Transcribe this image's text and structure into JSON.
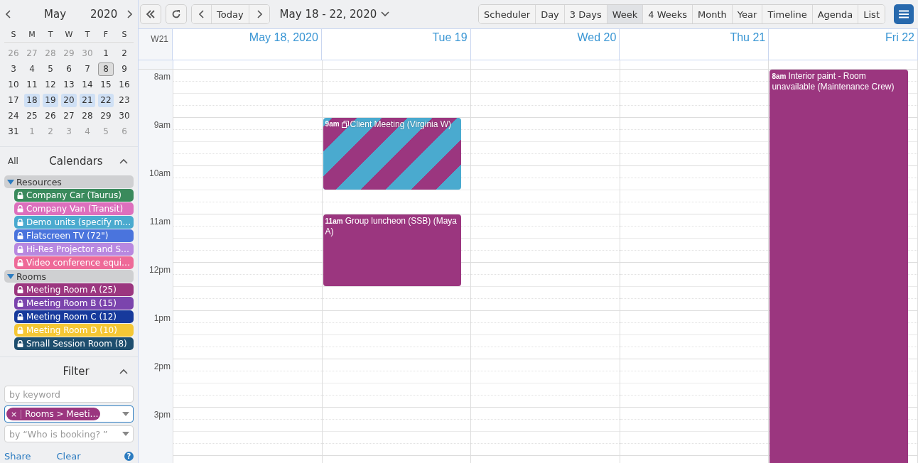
{
  "mini_calendar": {
    "month": "May",
    "year": "2020",
    "weekdays": [
      "S",
      "M",
      "T",
      "W",
      "T",
      "F",
      "S"
    ],
    "weeks": [
      [
        {
          "d": "26",
          "muted": true,
          "selected": false,
          "today": false
        },
        {
          "d": "27",
          "muted": true,
          "selected": false,
          "today": false
        },
        {
          "d": "28",
          "muted": true,
          "selected": false,
          "today": false
        },
        {
          "d": "29",
          "muted": true,
          "selected": false,
          "today": false
        },
        {
          "d": "30",
          "muted": true,
          "selected": false,
          "today": false
        },
        {
          "d": "1",
          "muted": false,
          "selected": false,
          "today": false
        },
        {
          "d": "2",
          "muted": false,
          "selected": false,
          "today": false
        }
      ],
      [
        {
          "d": "3",
          "muted": false,
          "selected": false,
          "today": false
        },
        {
          "d": "4",
          "muted": false,
          "selected": false,
          "today": false
        },
        {
          "d": "5",
          "muted": false,
          "selected": false,
          "today": false
        },
        {
          "d": "6",
          "muted": false,
          "selected": false,
          "today": false
        },
        {
          "d": "7",
          "muted": false,
          "selected": false,
          "today": false
        },
        {
          "d": "8",
          "muted": false,
          "selected": false,
          "today": true
        },
        {
          "d": "9",
          "muted": false,
          "selected": false,
          "today": false
        }
      ],
      [
        {
          "d": "10",
          "muted": false,
          "selected": false,
          "today": false
        },
        {
          "d": "11",
          "muted": false,
          "selected": false,
          "today": false
        },
        {
          "d": "12",
          "muted": false,
          "selected": false,
          "today": false
        },
        {
          "d": "13",
          "muted": false,
          "selected": false,
          "today": false
        },
        {
          "d": "14",
          "muted": false,
          "selected": false,
          "today": false
        },
        {
          "d": "15",
          "muted": false,
          "selected": false,
          "today": false
        },
        {
          "d": "16",
          "muted": false,
          "selected": false,
          "today": false
        }
      ],
      [
        {
          "d": "17",
          "muted": false,
          "selected": false,
          "today": false
        },
        {
          "d": "18",
          "muted": false,
          "selected": true,
          "today": false
        },
        {
          "d": "19",
          "muted": false,
          "selected": true,
          "today": false
        },
        {
          "d": "20",
          "muted": false,
          "selected": true,
          "today": false
        },
        {
          "d": "21",
          "muted": false,
          "selected": true,
          "today": false
        },
        {
          "d": "22",
          "muted": false,
          "selected": true,
          "today": false
        },
        {
          "d": "23",
          "muted": false,
          "selected": false,
          "today": false
        }
      ],
      [
        {
          "d": "24",
          "muted": false,
          "selected": false,
          "today": false
        },
        {
          "d": "25",
          "muted": false,
          "selected": false,
          "today": false
        },
        {
          "d": "26",
          "muted": false,
          "selected": false,
          "today": false
        },
        {
          "d": "27",
          "muted": false,
          "selected": false,
          "today": false
        },
        {
          "d": "28",
          "muted": false,
          "selected": false,
          "today": false
        },
        {
          "d": "29",
          "muted": false,
          "selected": false,
          "today": false
        },
        {
          "d": "30",
          "muted": false,
          "selected": false,
          "today": false
        }
      ],
      [
        {
          "d": "31",
          "muted": false,
          "selected": false,
          "today": false
        },
        {
          "d": "1",
          "muted": true,
          "selected": false,
          "today": false
        },
        {
          "d": "2",
          "muted": true,
          "selected": false,
          "today": false
        },
        {
          "d": "3",
          "muted": true,
          "selected": false,
          "today": false
        },
        {
          "d": "4",
          "muted": true,
          "selected": false,
          "today": false
        },
        {
          "d": "5",
          "muted": true,
          "selected": false,
          "today": false
        },
        {
          "d": "6",
          "muted": true,
          "selected": false,
          "today": false
        }
      ]
    ]
  },
  "calendars": {
    "all_label": "All",
    "title": "Calendars",
    "groups": [
      {
        "label": "Resources",
        "expanded": true,
        "items": [
          {
            "label": "Company Car (Taurus)",
            "color": "#3a8a5c"
          },
          {
            "label": "Company Van (Transit)",
            "color": "#dd6fbd"
          },
          {
            "label": "Demo units (specify m…",
            "color": "#4aaacf"
          },
          {
            "label": "Flatscreen TV (72\")",
            "color": "#4a74dd"
          },
          {
            "label": "Hi-Res Projector and S…",
            "color": "#b888e0"
          },
          {
            "label": "Video conference equi…",
            "color": "#ee6a98"
          }
        ]
      },
      {
        "label": "Rooms",
        "expanded": true,
        "items": [
          {
            "label": "Meeting Room A (25)",
            "color": "#9b367f"
          },
          {
            "label": "Meeting Room B (15)",
            "color": "#7b44ad"
          },
          {
            "label": "Meeting Room C (12)",
            "color": "#173a9c"
          },
          {
            "label": "Meeting Room D (10)",
            "color": "#f5c735"
          },
          {
            "label": "Small Session Room (8)",
            "color": "#1e4e6e"
          }
        ]
      }
    ]
  },
  "filter": {
    "title": "Filter",
    "keyword_placeholder": "by keyword",
    "tag": {
      "remove": "×",
      "label": "Rooms > Meeti…",
      "color": "#9b367f"
    },
    "booking_placeholder": "by “Who is booking? ”",
    "links": [
      "Share",
      "Clear"
    ],
    "help": "?"
  },
  "toolbar": {
    "today": "Today",
    "range": "May 18 - 22, 2020",
    "views": [
      {
        "label": "Scheduler",
        "selected": false
      },
      {
        "label": "Day",
        "selected": false
      },
      {
        "label": "3 Days",
        "selected": false
      },
      {
        "label": "Week",
        "selected": true
      },
      {
        "label": "4 Weeks",
        "selected": false
      },
      {
        "label": "Month",
        "selected": false
      },
      {
        "label": "Year",
        "selected": false
      },
      {
        "label": "Timeline",
        "selected": false
      },
      {
        "label": "Agenda",
        "selected": false
      },
      {
        "label": "List",
        "selected": false
      }
    ]
  },
  "week": {
    "label": "W21",
    "days": [
      "May 18, 2020",
      "Tue 19",
      "Wed 20",
      "Thu 21",
      "Fri 22"
    ],
    "hours": [
      "8am",
      "9am",
      "10am",
      "11am",
      "12pm",
      "1pm",
      "2pm",
      "3pm"
    ],
    "events": [
      {
        "time": "9am",
        "title": "Client Meeting (Virginia W)",
        "kind": "striped",
        "color": "#4aaacf",
        "stripes": {
          "color": "#9b367f"
        },
        "recurring": true
      },
      {
        "time": "11am",
        "title": "Group luncheon (SSB) (Maya A)",
        "kind": "solid",
        "color": "#9b367f",
        "recurring": false
      },
      {
        "time": "8am",
        "title": "Interior paint - Room unavailable (Maintenance Crew)",
        "kind": "solid",
        "color": "#9b367f",
        "recurring": false
      }
    ]
  }
}
